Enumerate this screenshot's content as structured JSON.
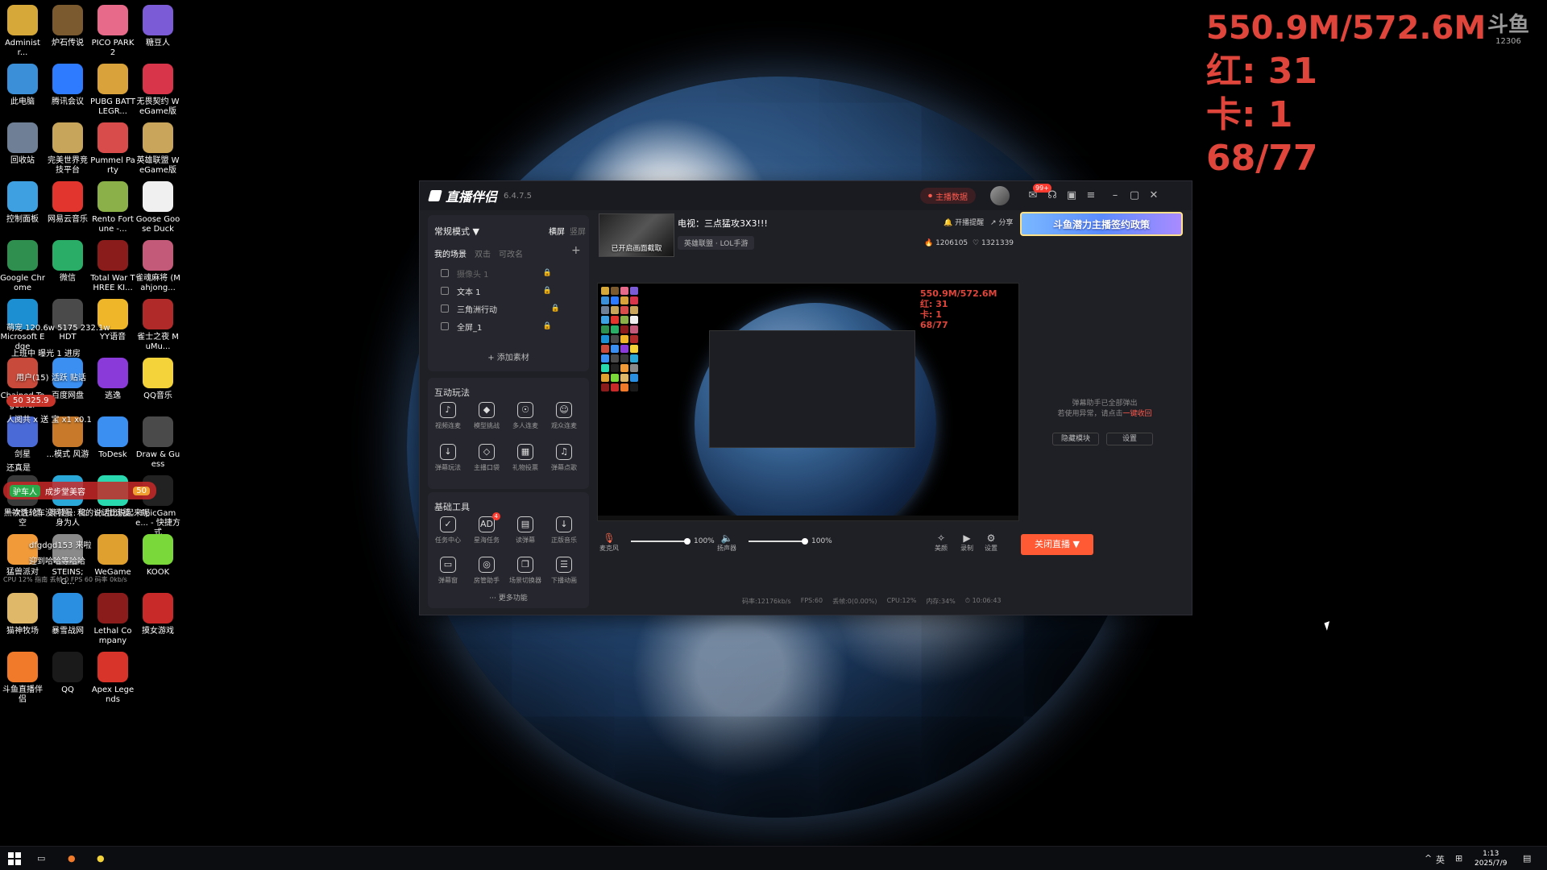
{
  "desktop": {
    "icons": [
      {
        "label": "Administr...",
        "color": "#d6a83a"
      },
      {
        "label": "炉石传说",
        "color": "#7a5a2e"
      },
      {
        "label": "PICO PARK 2",
        "color": "#e86a8a"
      },
      {
        "label": "糖豆人",
        "color": "#7b5cd6"
      },
      {
        "label": "此电脑",
        "color": "#3a8fd8"
      },
      {
        "label": "腾讯会议",
        "color": "#2f7bff"
      },
      {
        "label": "PUBG BATTLEGR...",
        "color": "#d9a23b"
      },
      {
        "label": "无畏契约 WeGame版",
        "color": "#d8344a"
      },
      {
        "label": "回收站",
        "color": "#6f7f95"
      },
      {
        "label": "完美世界竞技平台",
        "color": "#c7a55a"
      },
      {
        "label": "Pummel Party",
        "color": "#d94c4c"
      },
      {
        "label": "英雄联盟 WeGame版",
        "color": "#c8a55a"
      },
      {
        "label": "控制面板",
        "color": "#3ea0e0"
      },
      {
        "label": "网易云音乐",
        "color": "#e2352e"
      },
      {
        "label": "Rento Fortune -...",
        "color": "#8bb04a"
      },
      {
        "label": "Goose Goose Duck",
        "color": "#f0f0f0"
      },
      {
        "label": "Google Chrome",
        "color": "#2f8f4f"
      },
      {
        "label": "微信",
        "color": "#2aae67"
      },
      {
        "label": "Total War THREE KI...",
        "color": "#8a1c1c"
      },
      {
        "label": "雀魂麻将 (Mahjong...",
        "color": "#c45a7a"
      },
      {
        "label": "Microsoft Edge",
        "color": "#1b8fd1"
      },
      {
        "label": "HDT",
        "color": "#4a4a4a"
      },
      {
        "label": "YY语音",
        "color": "#f0b62a"
      },
      {
        "label": "雀士之夜 MuMu...",
        "color": "#b02a2a"
      },
      {
        "label": "Chained Together",
        "color": "#c84a3a"
      },
      {
        "label": "百度网盘",
        "color": "#3a8ff0"
      },
      {
        "label": "逃逸",
        "color": "#8a3ad8"
      },
      {
        "label": "QQ音乐",
        "color": "#f3d23a"
      },
      {
        "label": "剑星",
        "color": "#4a6ad8"
      },
      {
        "label": "...模式 风游",
        "color": "#c87a2a"
      },
      {
        "label": "ToDesk",
        "color": "#3a8ff0"
      },
      {
        "label": "Draw & Guess",
        "color": "#4a4a4a"
      },
      {
        "label": "黑神话: 悟空",
        "color": "#3a3a3a"
      },
      {
        "label": "奥特曼: 化身为人",
        "color": "#2aa8d8"
      },
      {
        "label": "UU加速器",
        "color": "#2ad8b0"
      },
      {
        "label": "EpicGame... - 快捷方式",
        "color": "#222222"
      },
      {
        "label": "猛兽派对",
        "color": "#f09a3a"
      },
      {
        "label": "STEINS;G...",
        "color": "#8a8a8a"
      },
      {
        "label": "WeGame",
        "color": "#e0a030"
      },
      {
        "label": "KOOK",
        "color": "#7ad83a"
      },
      {
        "label": "猫神牧场",
        "color": "#e0b86a"
      },
      {
        "label": "暴雪战网",
        "color": "#2a8fe0"
      },
      {
        "label": "Lethal Company",
        "color": "#8a1c1c"
      },
      {
        "label": "摸女游戏",
        "color": "#c82a2a"
      },
      {
        "label": "斗鱼直播伴侣",
        "color": "#f07a2a"
      },
      {
        "label": "QQ",
        "color": "#1a1a1a"
      },
      {
        "label": "Apex Legends",
        "color": "#d8342a"
      }
    ],
    "chat": {
      "line1": "萌宠 120.6w  5175  232.1w",
      "line2": "上班中   曝光 1   进房",
      "line3": "用户(15)  活跃  贴话",
      "line4": "50   325.9",
      "line5": "人阅共 x 送 宝 x1  x0.1",
      "line6": "还真是",
      "guard_name": "驴车人",
      "guard_msg": "成步堂美容",
      "guard_badge": "50",
      "msg2": "一次性轮车没问题，和的说话比说起来呢",
      "msg3": "dfgdgd153 来啦",
      "msg4": "迎到哈哈等哈哈",
      "msg5": "CPU 12%  指南 丢帧 0  FPS 60  码率 0kb/s"
    }
  },
  "stream_overlay": {
    "memory": "550.9M/572.6M",
    "red": "红: 31",
    "lag": "卡: 1",
    "ratio": "68/77"
  },
  "douyu_logo": {
    "text": "斗鱼",
    "room": "12306"
  },
  "app": {
    "title": "直播伴侣",
    "version": "6.4.7.5",
    "live_data_label": "主播数据",
    "message_badge": "99+",
    "left_panel": {
      "mode": "常规模式 ▼",
      "orient_h": "横屏",
      "orient_v": "竖屏",
      "scene_tabs": [
        "我的场景",
        "双击",
        "可改名"
      ],
      "sources": [
        {
          "label": "摄像头 1"
        },
        {
          "label": "文本 1"
        },
        {
          "label": "三角洲行动"
        },
        {
          "label": "全屏_1"
        }
      ],
      "add_material": "+ 添加素材",
      "interact_title": "互动玩法",
      "interact_items": [
        "视频连麦",
        "模型挑战",
        "多人连麦",
        "观众连麦",
        "弹幕玩法",
        "主播口袋",
        "礼物投票",
        "弹幕点歌"
      ],
      "tools_title": "基础工具",
      "tools_items": [
        "任务中心",
        "星海任务",
        "读弹幕",
        "正版音乐",
        "弹幕窗",
        "房管助手",
        "场景切换器",
        "下播动画"
      ],
      "tools_badge": "4",
      "more": "··· 更多功能"
    },
    "room": {
      "cover_label": "已开启画面截取",
      "title": "电视：三点猛攻3X3!!!",
      "category": "英雄联盟 · LOL手游",
      "open_remind": "开播提醒",
      "share": "分享",
      "hot": "1206105",
      "fans": "1321339",
      "banner": "斗鱼潜力主播签约政策"
    },
    "preview": {
      "memory": "550.9M/572.6M",
      "red": "红: 31",
      "lag": "卡: 1",
      "ratio": "68/77"
    },
    "side_panel": {
      "msg1": "弹幕助手已全部弹出",
      "msg2": "若使用异常，请点击",
      "link": "一键收回",
      "hide_btn": "隐藏模块",
      "settings_btn": "设置"
    },
    "controls": {
      "mic_label": "麦克风",
      "mic_pct": "100%",
      "speaker_label": "扬声器",
      "speaker_pct": "100%",
      "mic_level": 1.0,
      "speaker_level": 1.0,
      "beauty": "美颜",
      "record": "录制",
      "settings": "设置",
      "stop_live": "关闭直播 ▼"
    },
    "status": {
      "bitrate": "码率:12176kb/s",
      "fps": "FPS:60",
      "drop": "丢帧:0(0.00%)",
      "cpu": "CPU:12%",
      "mem": "内存:34%",
      "time": "10:06:43"
    }
  },
  "taskbar": {
    "ime": "英",
    "time": "1:13",
    "date": "2025/7/9"
  }
}
